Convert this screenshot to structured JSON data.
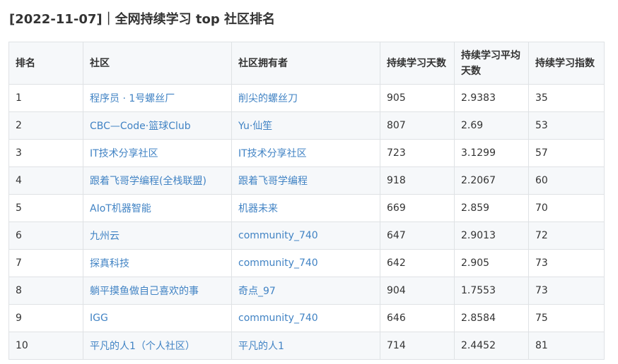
{
  "title": "[2022-11-07]｜全网持续学习 top 社区排名",
  "table": {
    "headers": [
      "排名",
      "社区",
      "社区拥有者",
      "持续学习天数",
      "持续学习平均天数",
      "持续学习指数"
    ],
    "rows": [
      {
        "rank": "1",
        "community": "程序员 · 1号螺丝厂",
        "owner": "削尖的螺丝刀",
        "days": "905",
        "avg": "2.9383",
        "index": "35"
      },
      {
        "rank": "2",
        "community": "CBC—Code·篮球Club",
        "owner": "Yu·仙笙",
        "days": "807",
        "avg": "2.69",
        "index": "53"
      },
      {
        "rank": "3",
        "community": "IT技术分享社区",
        "owner": "IT技术分享社区",
        "days": "723",
        "avg": "3.1299",
        "index": "57"
      },
      {
        "rank": "4",
        "community": "跟着飞哥学编程(全栈联盟)",
        "owner": "跟着飞哥学编程",
        "days": "918",
        "avg": "2.2067",
        "index": "60"
      },
      {
        "rank": "5",
        "community": "AIoT机器智能",
        "owner": "机器未来",
        "days": "669",
        "avg": "2.859",
        "index": "70"
      },
      {
        "rank": "6",
        "community": "九州云",
        "owner": "community_740",
        "days": "647",
        "avg": "2.9013",
        "index": "72"
      },
      {
        "rank": "7",
        "community": "探真科技",
        "owner": "community_740",
        "days": "642",
        "avg": "2.905",
        "index": "73"
      },
      {
        "rank": "8",
        "community": "躺平摸鱼做自己喜欢的事",
        "owner": "奇点_97",
        "days": "904",
        "avg": "1.7553",
        "index": "73"
      },
      {
        "rank": "9",
        "community": "IGG",
        "owner": "community_740",
        "days": "646",
        "avg": "2.8584",
        "index": "75"
      },
      {
        "rank": "10",
        "community": "平凡的人1（个人社区）",
        "owner": "平凡的人1",
        "days": "714",
        "avg": "2.4452",
        "index": "81"
      }
    ]
  },
  "colors": {
    "link": "#4183c4",
    "text": "#333333",
    "header_bg": "#f6f8fa",
    "border": "#dfe2e5"
  }
}
